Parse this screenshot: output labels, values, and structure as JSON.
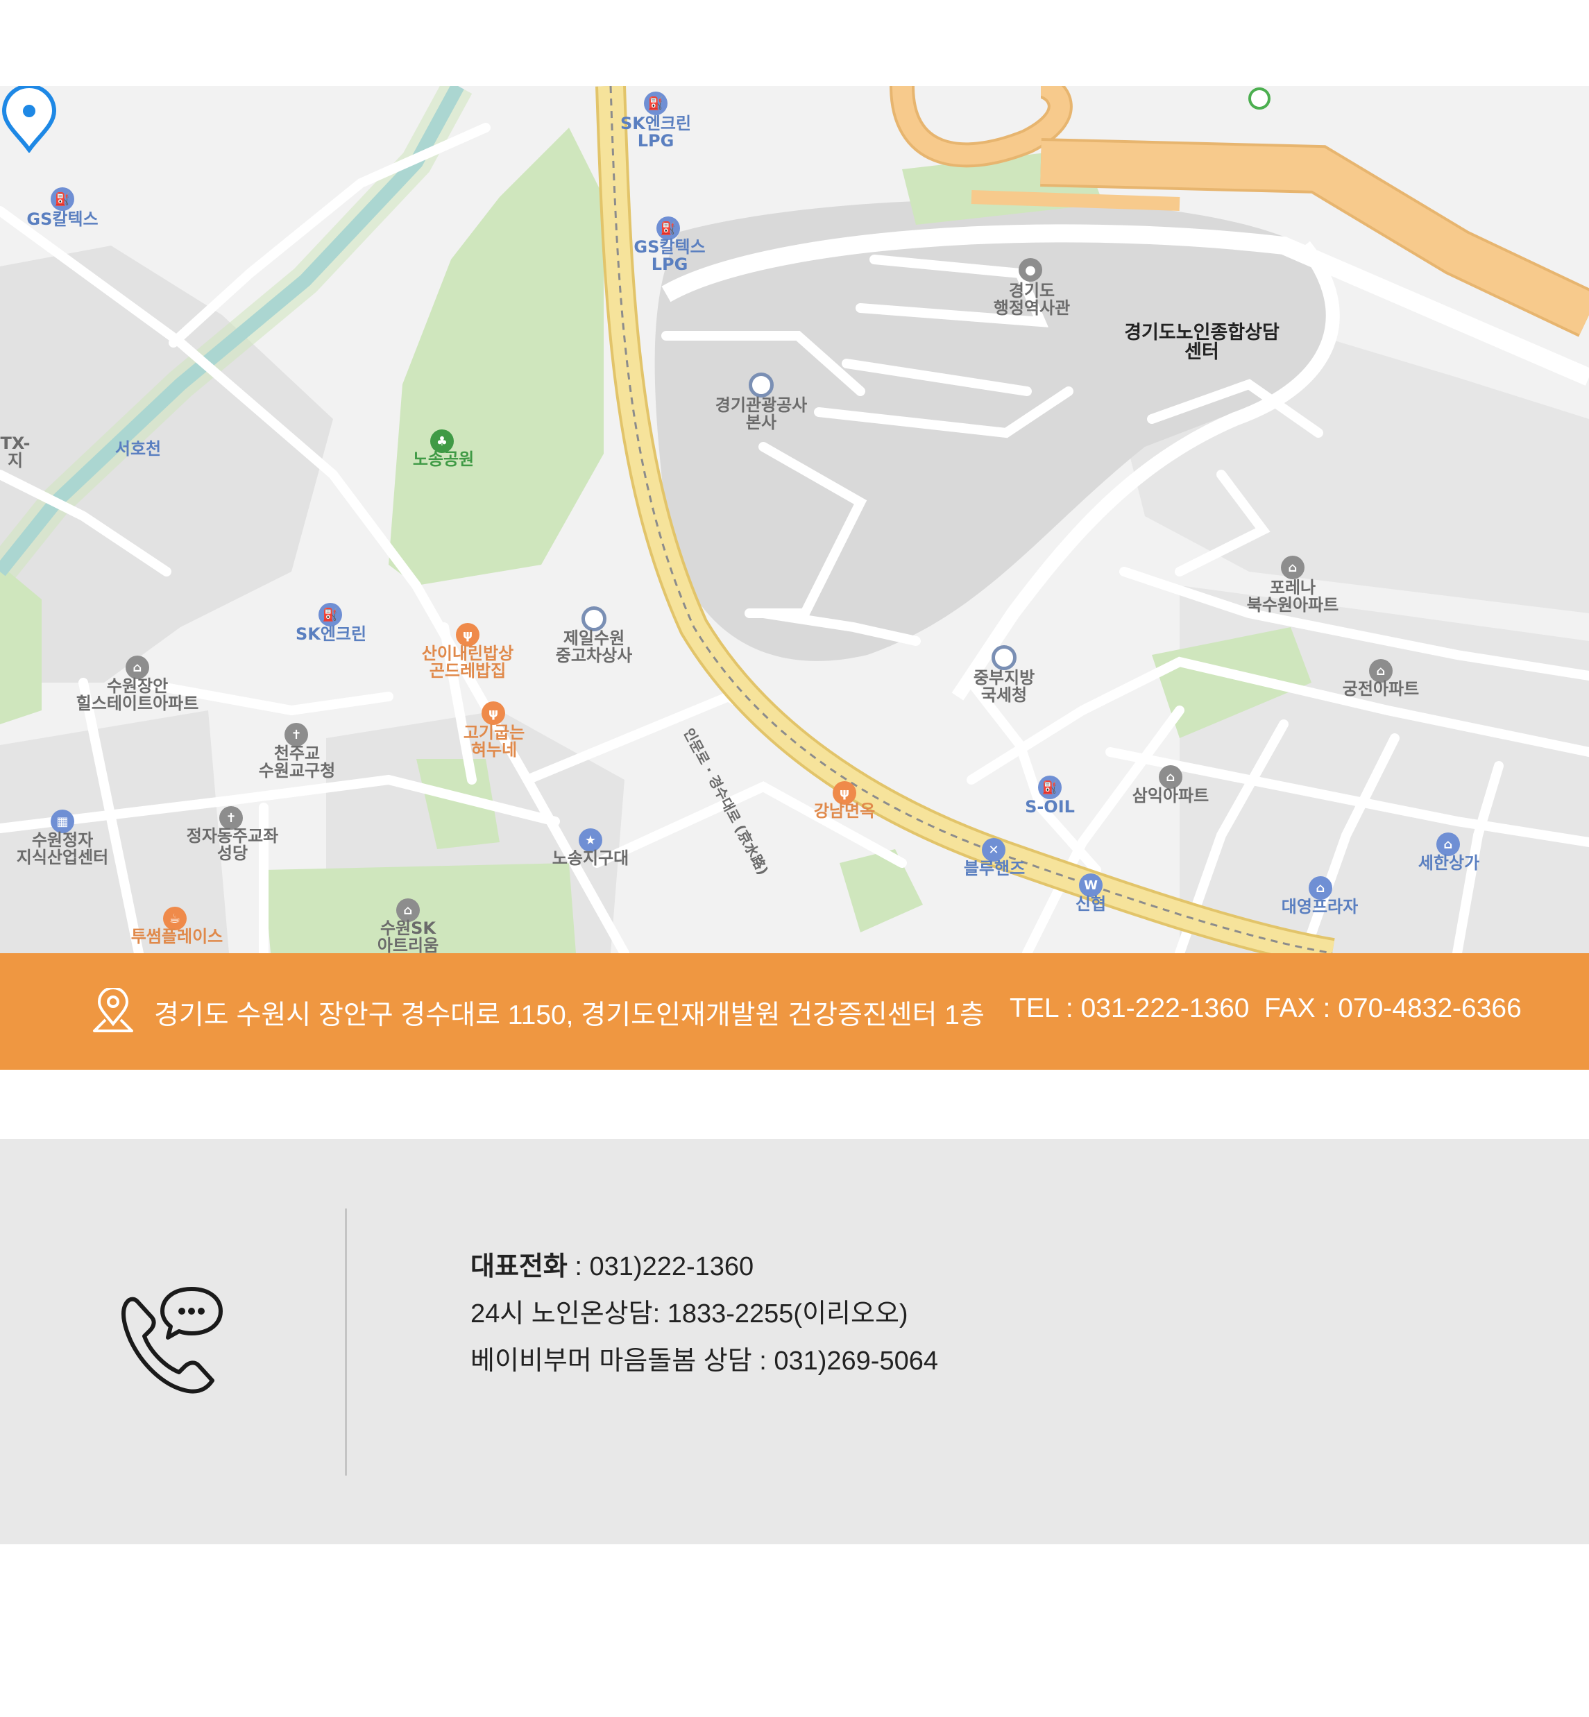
{
  "map": {
    "center_place": "경기도노인종합상담센터",
    "labels": [
      {
        "text": [
          "SK엔크린",
          "LPG"
        ],
        "color": "blue"
      },
      {
        "text": [
          "GS칼텍스"
        ],
        "color": "blue"
      },
      {
        "text": [
          "GS칼텍스",
          "LPG"
        ],
        "color": "blue"
      },
      {
        "text": [
          "경기도",
          "행정역사관"
        ],
        "color": "gray"
      },
      {
        "text": [
          "경기도노인종합상담",
          "센터"
        ],
        "color": "black"
      },
      {
        "text": [
          "경기관광공사",
          "본사"
        ],
        "color": "gray"
      },
      {
        "text": [
          "TX-",
          "지"
        ],
        "color": "gray"
      },
      {
        "text": [
          "서호천"
        ],
        "color": "blue"
      },
      {
        "text": [
          "노송공원"
        ],
        "color": "green"
      },
      {
        "text": [
          "포레나",
          "북수원아파트"
        ],
        "color": "gray"
      },
      {
        "text": [
          "SK엔크린"
        ],
        "color": "blue"
      },
      {
        "text": [
          "산이내린밥상",
          "곤드레밥집"
        ],
        "color": "orange"
      },
      {
        "text": [
          "제일수원",
          "중고차상사"
        ],
        "color": "gray"
      },
      {
        "text": [
          "중부지방",
          "국세청"
        ],
        "color": "gray"
      },
      {
        "text": [
          "궁전아파트"
        ],
        "color": "gray"
      },
      {
        "text": [
          "수원장안",
          "힐스테이트아파트"
        ],
        "color": "gray"
      },
      {
        "text": [
          "고기굽는",
          "혀누네"
        ],
        "color": "orange"
      },
      {
        "text": [
          "천주교",
          "수원교구청"
        ],
        "color": "gray"
      },
      {
        "text": [
          "S-OIL"
        ],
        "color": "blue"
      },
      {
        "text": [
          "삼익아파트"
        ],
        "color": "gray"
      },
      {
        "text": [
          "강남면옥"
        ],
        "color": "orange"
      },
      {
        "text": [
          "수원정자",
          "지식산업센터"
        ],
        "color": "gray"
      },
      {
        "text": [
          "정자동주교좌",
          "성당"
        ],
        "color": "gray"
      },
      {
        "text": [
          "노송지구대"
        ],
        "color": "gray"
      },
      {
        "text": [
          "블루핸즈"
        ],
        "color": "blue"
      },
      {
        "text": [
          "세한상가"
        ],
        "color": "blue"
      },
      {
        "text": [
          "신협"
        ],
        "color": "blue"
      },
      {
        "text": [
          "대영프라자"
        ],
        "color": "blue"
      },
      {
        "text": [
          "투썸플레이스"
        ],
        "color": "orange"
      },
      {
        "text": [
          "수원SK",
          "아트리움"
        ],
        "color": "gray"
      }
    ],
    "road_label": "인문로 · 경수대로 (京水路)",
    "colors": {
      "land": "#f2f2f2",
      "block": "#e2e2e2",
      "campus": "#d9d9d9",
      "park": "#cfe6bd",
      "water": "#7fc4e8",
      "highway": "#f7ca8c",
      "mainroad": "#f6e39b",
      "road": "#ffffff",
      "marker": "#1e88e5"
    }
  },
  "address_bar": {
    "icon": "location-pin-icon",
    "address": "경기도 수원시 장안구 경수대로 1150, 경기도인재개발원 건강증진센터 1층",
    "tel": "TEL : 031-222-1360",
    "fax": "FAX : 070-4832-6366",
    "bg_color": "#ef9741"
  },
  "contact": {
    "icon": "phone-chat-icon",
    "main_label": "대표전화",
    "main_value": " : 031)222-1360",
    "line2": "24시 노인온상담: 1833-2255(이리오오)",
    "line3": "베이비부머 마음돌봄 상담 : 031)269-5064",
    "bg_color": "#e8e8e8"
  }
}
